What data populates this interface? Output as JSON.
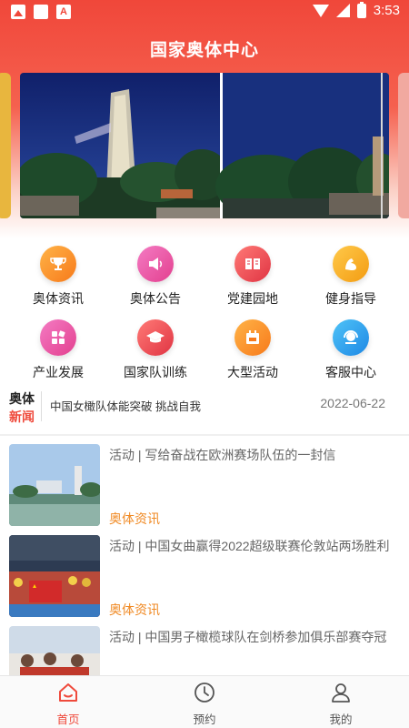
{
  "status_bar": {
    "time": "3:53",
    "left_icons": [
      "image-notification-icon",
      "image-notification-icon",
      "app-a-notification-icon"
    ],
    "right_icons": [
      "wifi-icon",
      "signal-icon",
      "battery-icon"
    ]
  },
  "header": {
    "title": "国家奥体中心"
  },
  "banner": {
    "images": [
      "stadium-tower-night-photo",
      "stadium-gate-night-photo"
    ]
  },
  "quick_menu": {
    "items": [
      {
        "label": "奥体资讯",
        "icon": "trophy-icon",
        "color": "#f77a1b"
      },
      {
        "label": "奥体公告",
        "icon": "megaphone-icon",
        "color": "#e3408f"
      },
      {
        "label": "党建园地",
        "icon": "book-icon",
        "color": "#e03443"
      },
      {
        "label": "健身指导",
        "icon": "muscle-arm-icon",
        "color": "#f39c12"
      },
      {
        "label": "产业发展",
        "icon": "blocks-icon",
        "color": "#e3408f"
      },
      {
        "label": "国家队训练",
        "icon": "graduation-cap-icon",
        "color": "#e03443"
      },
      {
        "label": "大型活动",
        "icon": "calendar-icon",
        "color": "#f77a1b"
      },
      {
        "label": "客服中心",
        "icon": "customer-service-icon",
        "color": "#1e88e5"
      }
    ]
  },
  "news_strip": {
    "tag_line1": "奥体",
    "tag_line2": "新闻",
    "headline": "中国女橄队体能突破 挑战自我",
    "date": "2022-06-22"
  },
  "articles": [
    {
      "title": "活动 | 写给奋战在欧洲赛场队伍的一封信",
      "category": "奥体资讯"
    },
    {
      "title": "活动 | 中国女曲赢得2022超级联赛伦敦站两场胜利",
      "category": "奥体资讯"
    },
    {
      "title": "活动 | 中国男子橄榄球队在剑桥参加俱乐部赛夺冠",
      "category": ""
    }
  ],
  "tab_bar": {
    "tabs": [
      {
        "label": "首页",
        "icon": "home-icon",
        "active": true
      },
      {
        "label": "预约",
        "icon": "clock-icon",
        "active": false
      },
      {
        "label": "我的",
        "icon": "user-icon",
        "active": false
      }
    ]
  },
  "colors": {
    "brand_red": "#ef4a3c",
    "category_orange": "#f08a24"
  }
}
